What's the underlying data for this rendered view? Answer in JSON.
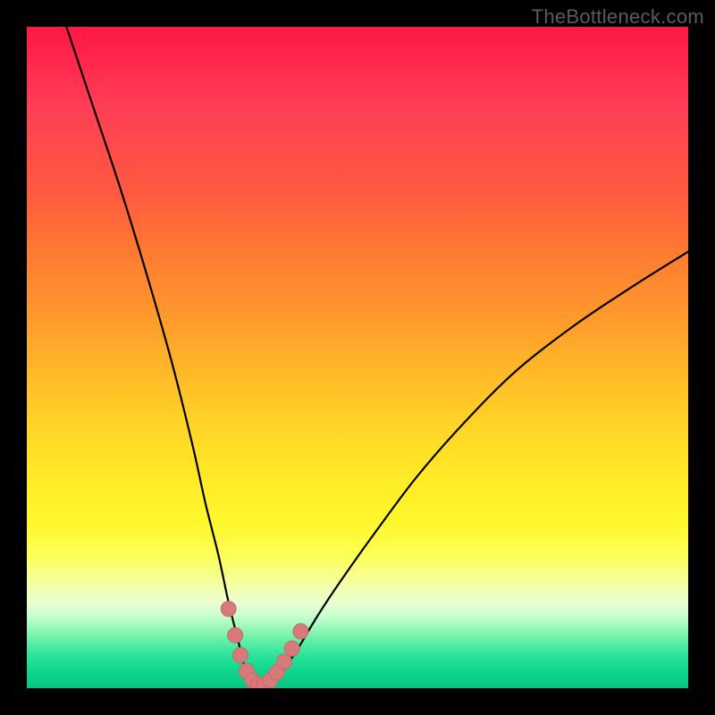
{
  "watermark": "TheBottleneck.com",
  "colors": {
    "frame": "#000000",
    "curve": "#000000",
    "marker_fill": "#d77a7a",
    "marker_stroke": "#c96a6a"
  },
  "chart_data": {
    "type": "line",
    "title": "",
    "xlabel": "",
    "ylabel": "",
    "xlim": [
      0,
      100
    ],
    "ylim": [
      0,
      100
    ],
    "note": "Axes are implicit (no tick labels shown). Curve is a V-shaped bottleneck curve; y≈0 is optimal (green), y≈100 is severe bottleneck (red). Values estimated from pixel positions.",
    "series": [
      {
        "name": "bottleneck-curve",
        "x": [
          6,
          10,
          14,
          18,
          22,
          25,
          27,
          29,
          30.5,
          32,
          33,
          34,
          35,
          36,
          37.5,
          39,
          41,
          44,
          48,
          53,
          59,
          66,
          74,
          83,
          92,
          100
        ],
        "y": [
          100,
          88,
          76,
          63,
          49,
          37,
          28,
          20,
          13,
          7,
          3,
          1,
          0,
          0,
          1,
          3,
          6,
          11,
          17,
          24,
          32,
          40,
          48,
          55,
          61,
          66
        ]
      }
    ],
    "markers": {
      "name": "highlighted-points",
      "x": [
        30.5,
        31.5,
        32.3,
        33.2,
        34.1,
        35.0,
        35.9,
        36.8,
        37.8,
        38.9,
        40.1,
        41.4
      ],
      "y": [
        12.0,
        8.0,
        5.0,
        2.6,
        1.2,
        0.5,
        0.5,
        1.2,
        2.4,
        4.0,
        6.0,
        8.6
      ]
    }
  }
}
